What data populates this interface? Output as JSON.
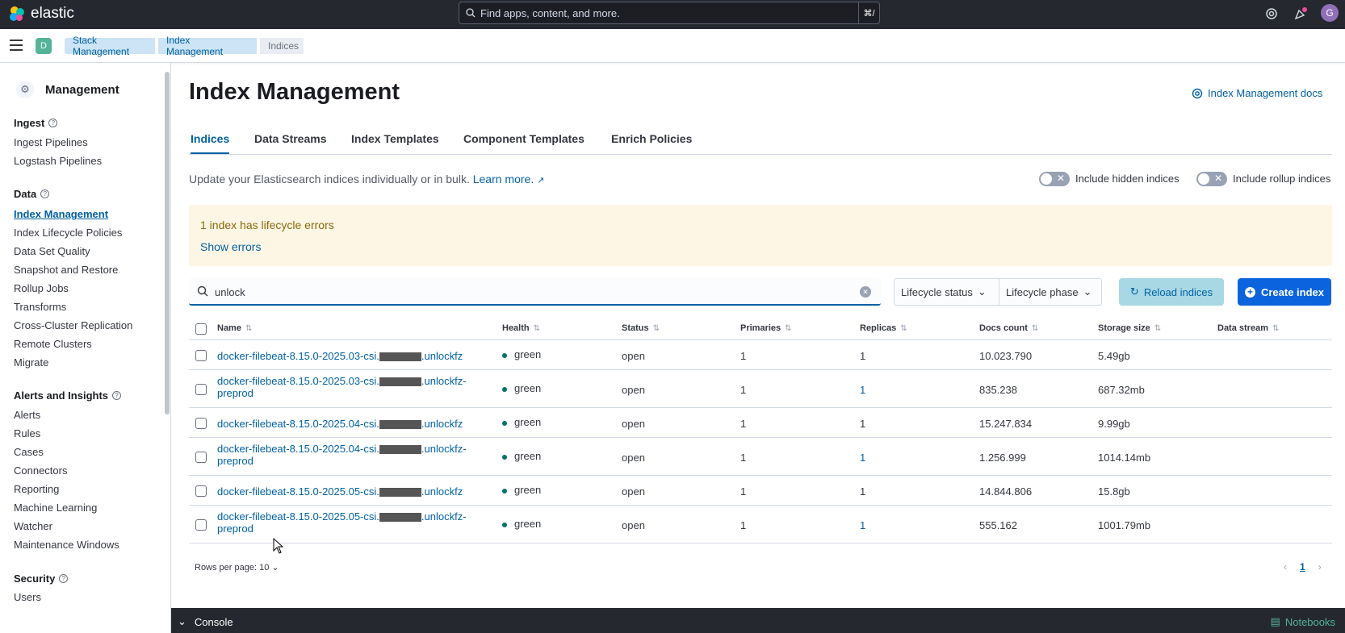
{
  "header": {
    "logo_text": "elastic",
    "search_placeholder": "Find apps, content, and more.",
    "search_shortcut": "⌘/",
    "avatar_initial": "G",
    "colors": {
      "topbar": "#25282f",
      "accent": "#0061a6"
    }
  },
  "breadcrumbs": {
    "space_initial": "D",
    "items": [
      "Stack Management",
      "Index Management",
      "Indices"
    ]
  },
  "sidebar": {
    "title": "Management",
    "groups": [
      {
        "label": "Ingest",
        "items": [
          "Ingest Pipelines",
          "Logstash Pipelines"
        ]
      },
      {
        "label": "Data",
        "items": [
          "Index Management",
          "Index Lifecycle Policies",
          "Data Set Quality",
          "Snapshot and Restore",
          "Rollup Jobs",
          "Transforms",
          "Cross-Cluster Replication",
          "Remote Clusters",
          "Migrate"
        ]
      },
      {
        "label": "Alerts and Insights",
        "items": [
          "Alerts",
          "Rules",
          "Cases",
          "Connectors",
          "Reporting",
          "Machine Learning",
          "Watcher",
          "Maintenance Windows"
        ]
      },
      {
        "label": "Security",
        "items": [
          "Users"
        ]
      }
    ],
    "active_item": "Index Management"
  },
  "main": {
    "title": "Index Management",
    "docs_link": "Index Management docs",
    "tabs": [
      "Indices",
      "Data Streams",
      "Index Templates",
      "Component Templates",
      "Enrich Policies"
    ],
    "active_tab": "Indices",
    "description": "Update your Elasticsearch indices individually or in bulk.",
    "learn_more": "Learn more.",
    "toggle_hidden": "Include hidden indices",
    "toggle_rollup": "Include rollup indices",
    "callout_title": "1 index has lifecycle errors",
    "callout_button": "Show errors",
    "search_value": "unlock",
    "filter_status": "Lifecycle status",
    "filter_phase": "Lifecycle phase",
    "reload_button": "Reload indices",
    "create_button": "Create index"
  },
  "table": {
    "columns": [
      "Name",
      "Health",
      "Status",
      "Primaries",
      "Replicas",
      "Docs count",
      "Storage size",
      "Data stream"
    ],
    "rows": [
      {
        "name_prefix": "docker-filebeat-8.15.0-2025.03-csi.",
        "name_suffix": ".unlockfz",
        "name_line2": "",
        "health": "green",
        "status": "open",
        "primaries": "1",
        "replicas": "1",
        "docs_count": "10.023.790",
        "storage_size": "5.49gb"
      },
      {
        "name_prefix": "docker-filebeat-8.15.0-2025.03-csi.",
        "name_suffix": ".unlockfz-",
        "name_line2": "preprod",
        "health": "green",
        "status": "open",
        "primaries": "1",
        "replicas": "1",
        "docs_count": "835.238",
        "storage_size": "687.32mb"
      },
      {
        "name_prefix": "docker-filebeat-8.15.0-2025.04-csi.",
        "name_suffix": ".unlockfz",
        "name_line2": "",
        "health": "green",
        "status": "open",
        "primaries": "1",
        "replicas": "1",
        "docs_count": "15.247.834",
        "storage_size": "9.99gb"
      },
      {
        "name_prefix": "docker-filebeat-8.15.0-2025.04-csi.",
        "name_suffix": ".unlockfz-",
        "name_line2": "preprod",
        "health": "green",
        "status": "open",
        "primaries": "1",
        "replicas": "1",
        "docs_count": "1.256.999",
        "storage_size": "1014.14mb"
      },
      {
        "name_prefix": "docker-filebeat-8.15.0-2025.05-csi.",
        "name_suffix": ".unlockfz",
        "name_line2": "",
        "health": "green",
        "status": "open",
        "primaries": "1",
        "replicas": "1",
        "docs_count": "14.844.806",
        "storage_size": "15.8gb"
      },
      {
        "name_prefix": "docker-filebeat-8.15.0-2025.05-csi.",
        "name_suffix": ".unlockfz-",
        "name_line2": "preprod",
        "health": "green",
        "status": "open",
        "primaries": "1",
        "replicas": "1",
        "docs_count": "555.162",
        "storage_size": "1001.79mb"
      }
    ],
    "rows_per_page": "Rows per page: 10",
    "current_page": "1"
  },
  "console": {
    "label": "Console",
    "notebooks": "Notebooks"
  }
}
